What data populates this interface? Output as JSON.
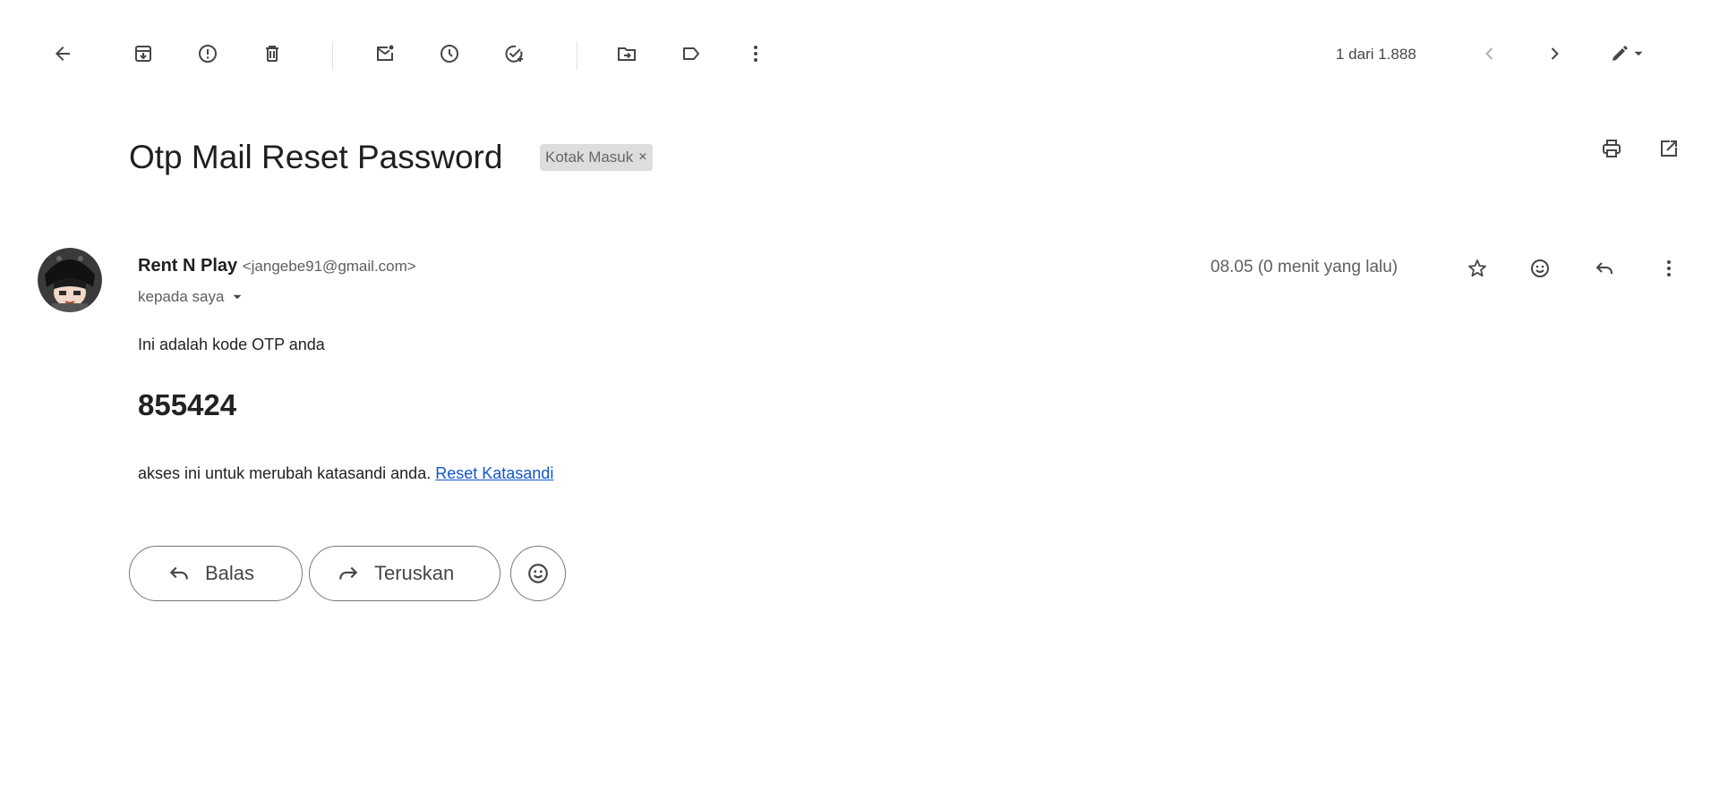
{
  "toolbar": {
    "icons": [
      "back-arrow-icon",
      "archive-icon",
      "report-spam-icon",
      "delete-icon",
      "mark-unread-icon",
      "snooze-icon",
      "add-task-icon",
      "move-to-icon",
      "label-icon",
      "more-vert-icon"
    ],
    "count_text": "1 dari 1.888"
  },
  "email": {
    "subject": "Otp Mail Reset Password",
    "label": "Kotak Masuk",
    "label_close": "×",
    "sender_name": "Rent N Play",
    "sender_email": "<jangebe91@gmail.com>",
    "recipient": "kepada saya",
    "date": "08.05 (0 menit yang lalu)",
    "intro": "Ini adalah kode OTP anda",
    "otp": "855424",
    "footer_text": "akses ini untuk merubah katasandi anda.",
    "link_text": "Reset Katasandi"
  },
  "actions": {
    "reply_label": "Balas",
    "forward_label": "Teruskan"
  },
  "colors": {
    "link": "#1155cc",
    "chip_bg": "#dddddd",
    "icon": "#444746"
  }
}
